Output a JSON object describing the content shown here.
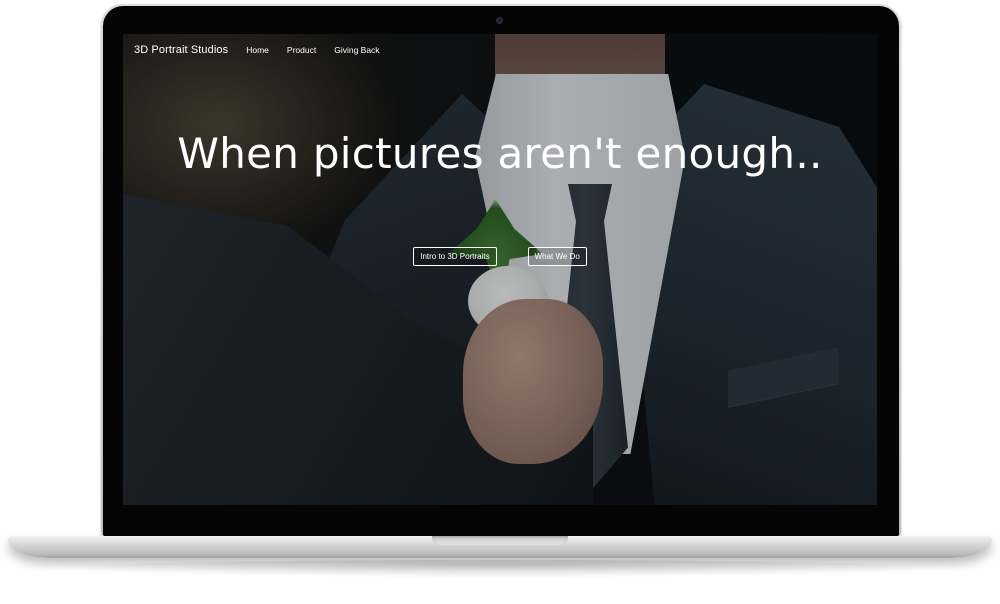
{
  "site": {
    "brand": "3D Portrait Studios",
    "nav": [
      {
        "label": "Home"
      },
      {
        "label": "Product"
      },
      {
        "label": "Giving Back"
      }
    ]
  },
  "hero": {
    "headline": "When pictures aren't enough..",
    "buttons": [
      {
        "label": "Intro to 3D Portraits"
      },
      {
        "label": "What We Do"
      }
    ]
  },
  "colors": {
    "text": "#ffffff",
    "laptop_frame": "#c9c9c9",
    "bezel": "#050505"
  }
}
